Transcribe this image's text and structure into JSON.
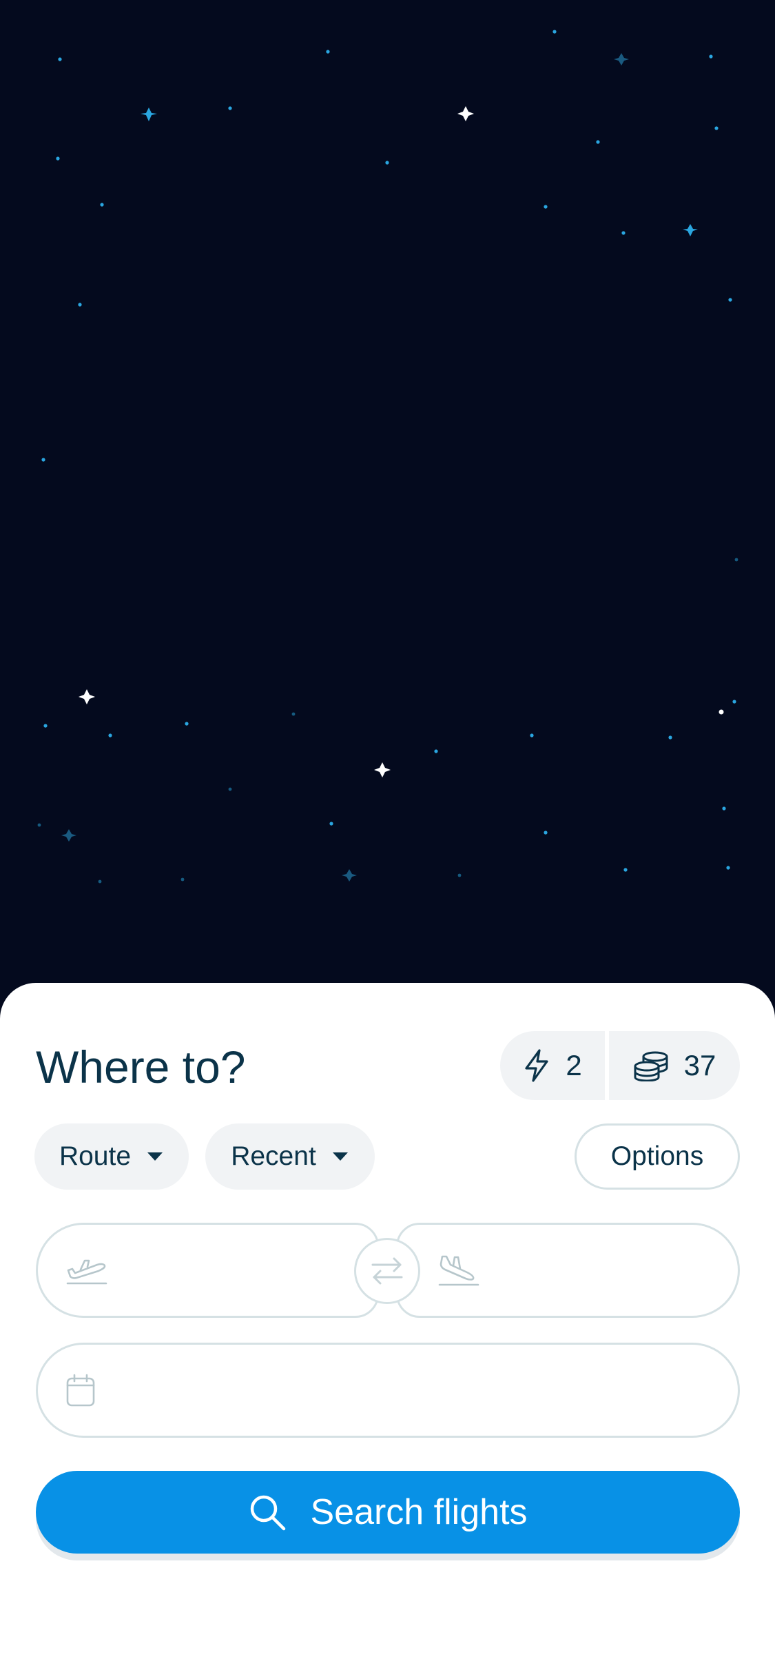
{
  "sheet": {
    "title": "Where to?"
  },
  "stats": {
    "boosts": {
      "icon": "lightning-bolt-icon",
      "count": "2"
    },
    "coins": {
      "icon": "coin-stack-icon",
      "count": "37"
    }
  },
  "filters": {
    "route_label": "Route",
    "recent_label": "Recent",
    "options_label": "Options"
  },
  "fields": {
    "origin": {
      "icon": "plane-takeoff-icon",
      "value": "",
      "placeholder": ""
    },
    "destination": {
      "icon": "plane-landing-icon",
      "value": "",
      "placeholder": ""
    },
    "date": {
      "icon": "calendar-icon",
      "value": "",
      "placeholder": ""
    },
    "swap_icon": "swap-arrows-icon"
  },
  "search": {
    "icon": "search-icon",
    "label": "Search flights"
  },
  "colors": {
    "sky": "#040a1e",
    "accent": "#0891e6",
    "text": "#0b3349",
    "chip_bg": "#f1f3f5",
    "border": "#d5e1e4"
  }
}
